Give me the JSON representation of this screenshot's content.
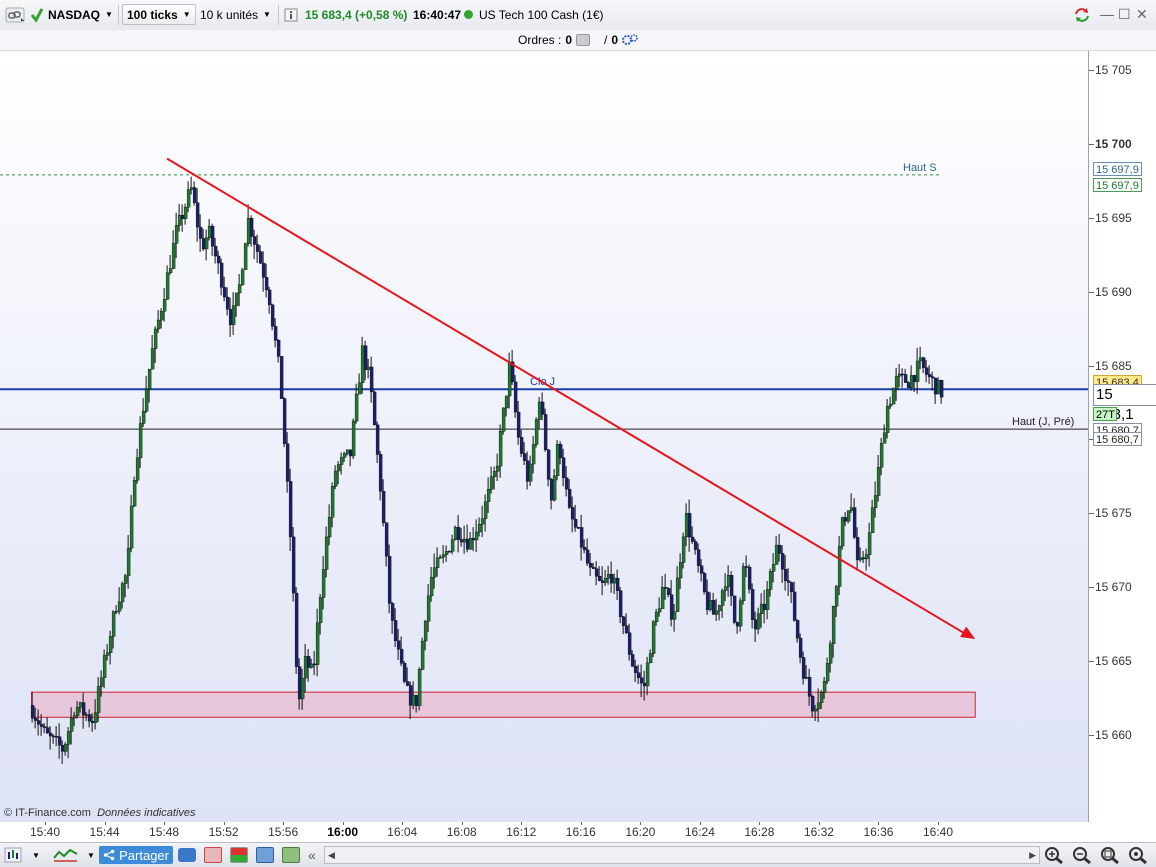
{
  "toolbar": {
    "instrument": "NASDAQ",
    "tick_interval": "100 ticks",
    "size": "10 k unités",
    "price_change": "15 683,4 (+0,58 %)",
    "time": "16:40:47",
    "instrument_full": "US Tech 100 Cash (1€)"
  },
  "orders": {
    "label": "Ordres :",
    "count_a": "0",
    "sep": "/",
    "count_b": "0"
  },
  "price_axis": {
    "ticks": [
      "15 705",
      "15 700",
      "15 695",
      "15 690",
      "15 685",
      "15 680",
      "15 675",
      "15 670",
      "15 665",
      "15 660"
    ],
    "labels": {
      "haut_top_1": "15 697,9",
      "haut_top_2": "15 697,9",
      "current_price_a": "15 683,4",
      "current_price_b": "15 683,1",
      "ticks_left": "27T",
      "haut_prev_1": "15 680,7",
      "haut_prev_2": "15 680,7"
    }
  },
  "chart_labels": {
    "haut_s": "Haut S",
    "haut_prev": "Haut (J, Pré)",
    "close": "Clo J",
    "watermark": "© IT-Finance.com",
    "indicative": "Données indicatives"
  },
  "time_axis": [
    "15:40",
    "15:44",
    "15:48",
    "15:52",
    "15:56",
    "16:00",
    "16:04",
    "16:08",
    "16:12",
    "16:16",
    "16:20",
    "16:24",
    "16:28",
    "16:32",
    "16:36",
    "16:40"
  ],
  "bottom": {
    "share_label": "Partager"
  },
  "colors": {
    "up": "#1f7a2e",
    "down": "#1b1f6e",
    "trendline": "#e8141a",
    "support_zone": "#e8bfd3",
    "close_line": "#1a3ea8"
  },
  "chart_data": {
    "type": "candlestick",
    "x_start": "15:39",
    "x_end": "16:41",
    "ylim": [
      15658,
      15707
    ],
    "price_anchors": [
      [
        "15:39.0",
        15662
      ],
      [
        "15:40.0",
        15660
      ],
      [
        "15:41.2",
        15659
      ],
      [
        "15:42.0",
        15662
      ],
      [
        "15:43.2",
        15661
      ],
      [
        "15:44.0",
        15665
      ],
      [
        "15:44.8",
        15669
      ],
      [
        "15:45.5",
        15671
      ],
      [
        "15:46.0",
        15678
      ],
      [
        "15:46.7",
        15683
      ],
      [
        "15:47.2",
        15686
      ],
      [
        "15:48.0",
        15690
      ],
      [
        "15:48.8",
        15694
      ],
      [
        "15:49.8",
        15697
      ],
      [
        "15:50.5",
        15693
      ],
      [
        "15:51.0",
        15694
      ],
      [
        "15:51.8",
        15691
      ],
      [
        "15:52.5",
        15688
      ],
      [
        "15:53.0",
        15690
      ],
      [
        "15:53.6",
        15695
      ],
      [
        "15:54.2",
        15693
      ],
      [
        "15:55.0",
        15690
      ],
      [
        "15:55.8",
        15684
      ],
      [
        "15:56.5",
        15673
      ],
      [
        "15:57.0",
        15662
      ],
      [
        "15:57.5",
        15665
      ],
      [
        "15:58.0",
        15664
      ],
      [
        "15:58.6",
        15671
      ],
      [
        "15:59.5",
        15678
      ],
      [
        "16:00.5",
        15679
      ],
      [
        "16:01.3",
        15686
      ],
      [
        "16:01.8",
        15684
      ],
      [
        "16:02.5",
        15677
      ],
      [
        "16:03.2",
        15668
      ],
      [
        "16:04.2",
        15663
      ],
      [
        "16:04.9",
        15662
      ],
      [
        "16:05.5",
        15668
      ],
      [
        "16:06.0",
        15671
      ],
      [
        "16:06.8",
        15672
      ],
      [
        "16:07.6",
        15674
      ],
      [
        "16:08.5",
        15673
      ],
      [
        "16:09.4",
        15675
      ],
      [
        "16:10.3",
        15678
      ],
      [
        "16:11.2",
        15685
      ],
      [
        "16:11.8",
        15680
      ],
      [
        "16:12.5",
        15677
      ],
      [
        "16:13.2",
        15683
      ],
      [
        "16:14.0",
        15676
      ],
      [
        "16:14.5",
        15680
      ],
      [
        "16:15.2",
        15675
      ],
      [
        "16:16.0",
        15673
      ],
      [
        "16:16.6",
        15671
      ],
      [
        "16:17.4",
        15670
      ],
      [
        "16:18.0",
        15671
      ],
      [
        "16:18.5",
        15669
      ],
      [
        "16:19.4",
        15665
      ],
      [
        "16:20.2",
        15663
      ],
      [
        "16:20.8",
        15667
      ],
      [
        "16:21.5",
        15670
      ],
      [
        "16:22.2",
        15668
      ],
      [
        "16:23.0",
        15675
      ],
      [
        "16:23.7",
        15672
      ],
      [
        "16:24.4",
        15669
      ],
      [
        "16:25.0",
        15668
      ],
      [
        "16:25.8",
        15671
      ],
      [
        "16:26.4",
        15667
      ],
      [
        "16:27.0",
        15672
      ],
      [
        "16:27.6",
        15667
      ],
      [
        "16:28.4",
        15669
      ],
      [
        "16:29.2",
        15673
      ],
      [
        "16:30.0",
        15670
      ],
      [
        "16:30.8",
        15665
      ],
      [
        "16:31.5",
        15662
      ],
      [
        "16:32.3",
        15663
      ],
      [
        "16:32.9",
        15668
      ],
      [
        "16:33.5",
        15674
      ],
      [
        "16:34.1",
        15676
      ],
      [
        "16:34.6",
        15671
      ],
      [
        "16:35.3",
        15673
      ],
      [
        "16:36.0",
        15678
      ],
      [
        "16:36.5",
        15682
      ],
      [
        "16:37.2",
        15684
      ],
      [
        "16:38.0",
        15684
      ],
      [
        "16:38.8",
        15685
      ],
      [
        "16:39.5",
        15684
      ],
      [
        "16:40.3",
        15683.1
      ]
    ],
    "trendline": {
      "from": [
        "15:48.2",
        15699
      ],
      "to": [
        "16:42.5",
        15666.5
      ]
    },
    "support_zone": {
      "x_from": "15:39.1",
      "x_to": "16:42.5",
      "y_from": 15661.2,
      "y_to": 15662.9
    },
    "hlines": [
      {
        "name": "Haut S",
        "y": 15697.9,
        "style": "dashed"
      },
      {
        "name": "Clo J",
        "y": 15683.4,
        "style": "solid"
      },
      {
        "name": "Haut (J, Pré)",
        "y": 15680.7,
        "style": "solid"
      }
    ]
  }
}
